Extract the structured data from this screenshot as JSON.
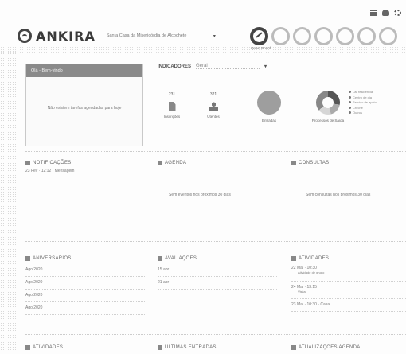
{
  "topbar": {
    "icons": [
      "grid-icon",
      "user-icon",
      "settings-icon"
    ]
  },
  "header": {
    "brand": "ANKIRA",
    "organization": "Santa Casa da Misericórdia de Alcochete",
    "dropdown_glyph": "▾",
    "badge_caption": "Quest Board"
  },
  "welcome": {
    "title": "Olá - Bem-vindo",
    "body": "Não existem tarefas agendadas para hoje"
  },
  "indicators": {
    "title": "INDICADORES",
    "select_value": "Geral",
    "items": [
      {
        "value": "231",
        "label": "Inscrições"
      },
      {
        "value": "321",
        "label": "Utentes"
      },
      {
        "value": "",
        "label": "Entradas"
      },
      {
        "value": "",
        "label": "Processos de Saída"
      }
    ],
    "legend": [
      "Lar residencial",
      "Centro de dia",
      "Serviço de apoio",
      "Creche",
      "Outros"
    ]
  },
  "cards": {
    "notifications": {
      "title": "NOTIFICAÇÕES",
      "entry": "23 Fev · 12:12 · Mensagem"
    },
    "agenda": {
      "title": "AGENDA",
      "empty": "Sem eventos nos próximos 30 dias"
    },
    "consultas": {
      "title": "CONSULTAS",
      "empty": "Sem consultas nos próximos 30 dias"
    },
    "aniversarios": {
      "title": "ANIVERSÁRIOS",
      "rows": [
        "Ago 2020",
        "Ago 2020",
        "Ago 2020",
        "Ago 2020"
      ]
    },
    "avaliacoes": {
      "title": "AVALIAÇÕES",
      "rows": [
        "15 abr",
        "21 abr"
      ]
    },
    "atividades": {
      "title": "ATIVIDADES",
      "rows": [
        "22 Mai · 10:30",
        "24 Mai · 13:15",
        "23 Mai · 10:30 · Casa"
      ],
      "subrows": [
        "Atividade de grupo",
        "Visita"
      ]
    },
    "bottom": {
      "left": "ATIVIDADES",
      "middle": "ÚLTIMAS ENTRADAS",
      "right": "ATUALIZAÇÕES AGENDA"
    }
  }
}
